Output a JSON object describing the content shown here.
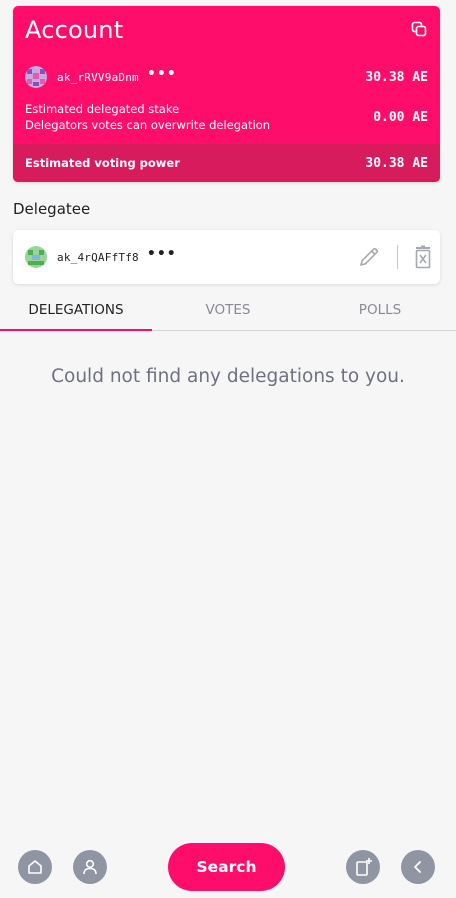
{
  "account": {
    "title": "Account",
    "address": "ak_rRVV9aDnm",
    "more": "•••",
    "balance": "30.38 AE",
    "stake_label_line1": "Estimated delegated stake",
    "stake_label_line2": "Delegators votes can overwrite delegation",
    "stake_value": "0.00 AE",
    "voting_power_label": "Estimated voting power",
    "voting_power_value": "30.38 AE",
    "accent_color": "#ff0d6a"
  },
  "delegatee": {
    "section_title": "Delegatee",
    "address": "ak_4rQAFfTf8",
    "more": "•••"
  },
  "tabs": [
    {
      "label": "DELEGATIONS",
      "active": true
    },
    {
      "label": "VOTES",
      "active": false
    },
    {
      "label": "POLLS",
      "active": false
    }
  ],
  "empty_message": "Could not find any delegations to you.",
  "bottom_nav": {
    "home_icon": "home-icon",
    "account_icon": "user-icon",
    "search_label": "Search",
    "create_icon": "add-document-icon",
    "back_icon": "chevron-left-icon"
  }
}
